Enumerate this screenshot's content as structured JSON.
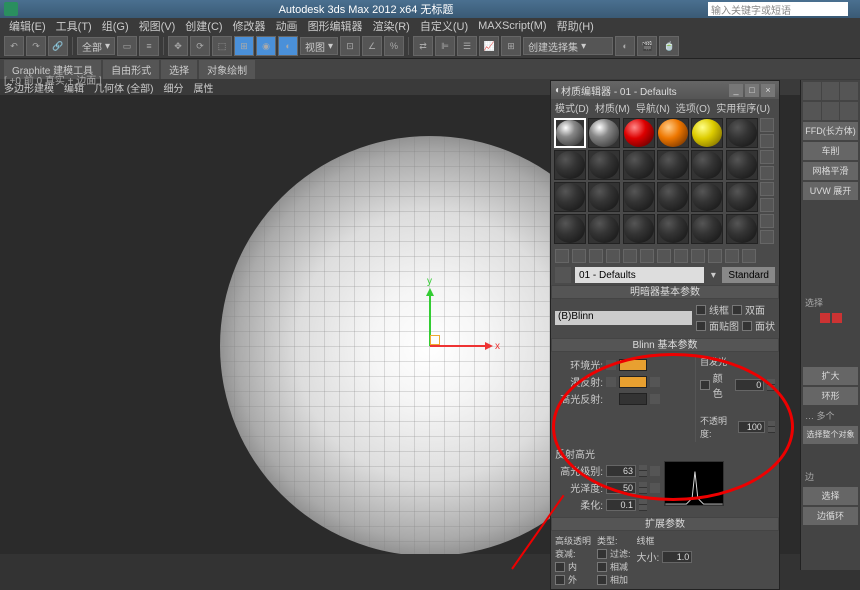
{
  "app": {
    "title": "Autodesk 3ds Max 2012 x64   无标题",
    "search_placeholder": "输入关键字或短语"
  },
  "menu": [
    "编辑(E)",
    "工具(T)",
    "组(G)",
    "视图(V)",
    "创建(C)",
    "修改器",
    "动画",
    "图形编辑器",
    "渲染(R)",
    "自定义(U)",
    "MAXScript(M)",
    "帮助(H)"
  ],
  "toolbar": {
    "view_dropdown": "全部",
    "shading_dropdown": "视图",
    "snaps_dropdown": "创建选择集"
  },
  "ribbon": {
    "tabs": [
      "Graphite 建模工具",
      "自由形式",
      "选择",
      "对象绘制"
    ],
    "sub": [
      "多边形建模",
      "编辑",
      "几何体 (全部)",
      "细分",
      "属性"
    ]
  },
  "viewport": {
    "label": "[ +0 前 0 真实 + 边面 ]"
  },
  "mat_editor": {
    "title": "材质编辑器 - 01 - Defaults",
    "menu": [
      "模式(D)",
      "材质(M)",
      "导航(N)",
      "选项(O)",
      "实用程序(U)"
    ],
    "name": "01 - Defaults",
    "type_btn": "Standard",
    "rollout_basic": "明暗器基本参数",
    "shader": "(B)Blinn",
    "chk_wire": "线框",
    "chk_2side": "双面",
    "chk_facemap": "面贴图",
    "chk_faceted": "面状",
    "rollout_blinn": "Blinn 基本参数",
    "self_illum": "自发光",
    "color_label": "颜色",
    "self_illum_val": "0",
    "ambient": "环境光:",
    "diffuse": "漫反射:",
    "specular": "高光反射:",
    "opacity": "不透明度:",
    "opacity_val": "100",
    "spec_highlights": "反射高光",
    "spec_level": "高光级别:",
    "spec_level_val": "63",
    "glossiness": "光泽度:",
    "glossiness_val": "50",
    "soften": "柔化:",
    "soften_val": "0.1",
    "rollout_ext": "扩展参数",
    "adv_transp": "高级透明",
    "falloff": "衰减:",
    "falloff_in": "内",
    "falloff_out": "外",
    "type_lbl": "类型:",
    "type_filter": "过滤:",
    "type_sub": "相减",
    "type_add": "相加",
    "wire_section": "线框",
    "size_lbl": "大小:",
    "size_val": "1.0"
  },
  "cmdpanel": {
    "ffd": "FFD(长方体)",
    "lathe": "车削",
    "mesh_smooth": "网格平滑",
    "uvw": "UVW 展开",
    "label_select": "选择",
    "expand": "扩大",
    "shrink": "环形",
    "more": "… 多个",
    "sel_whole": "选择整个对象",
    "edge_label": "边",
    "sel_label": "选择",
    "ring": "边循环"
  }
}
